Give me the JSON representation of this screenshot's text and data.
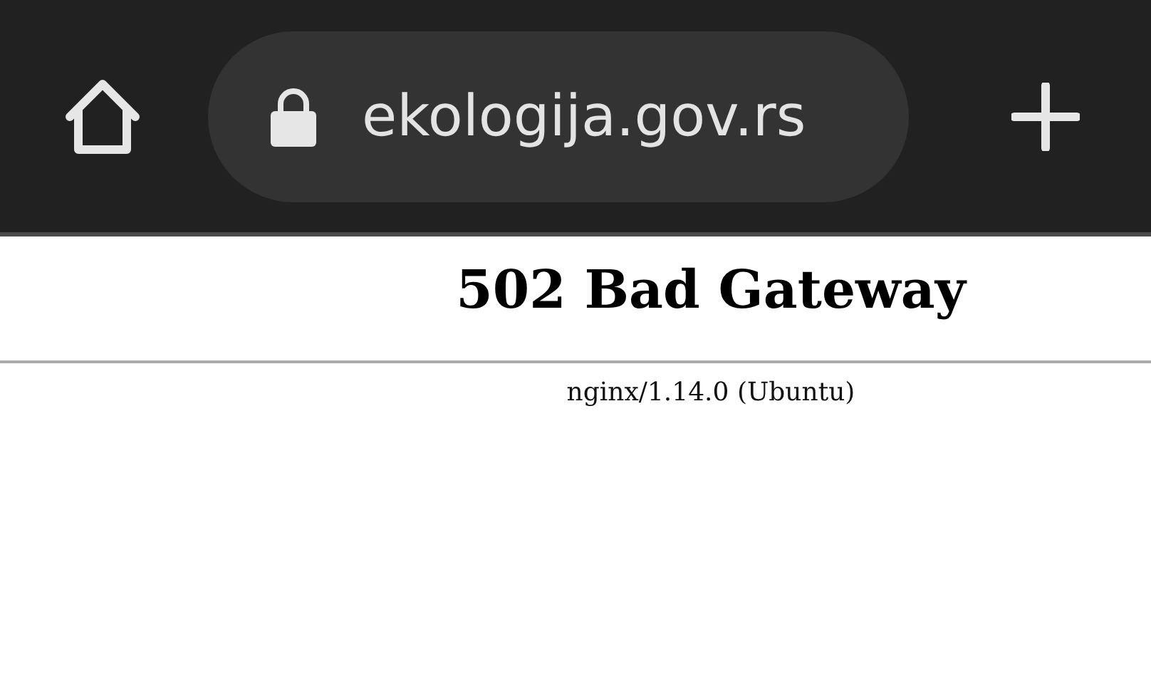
{
  "browser": {
    "url": "ekologija.gov.rs",
    "secure": true
  },
  "page": {
    "heading": "502 Bad Gateway",
    "footer": "nginx/1.14.0 (Ubuntu)"
  }
}
